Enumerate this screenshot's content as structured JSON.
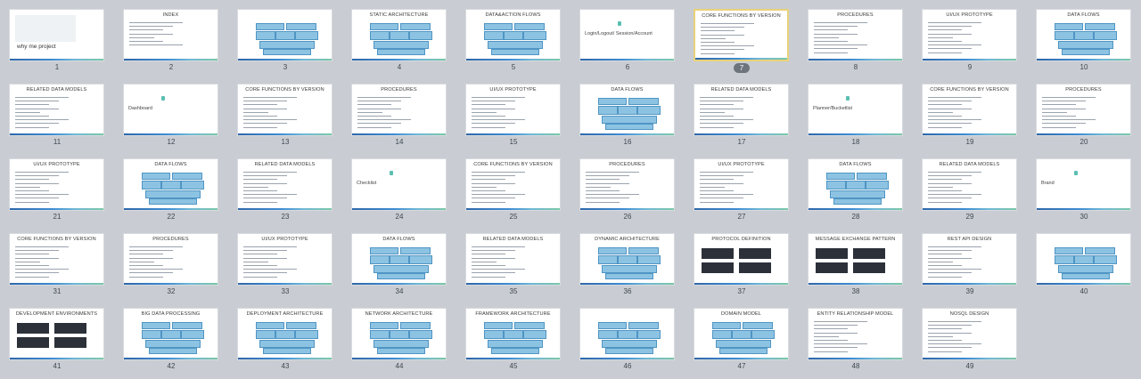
{
  "selected_slide": 7,
  "slides": [
    {
      "n": "1",
      "title": "",
      "kind": "cover",
      "cover_title": "why me project"
    },
    {
      "n": "2",
      "title": "INDEX",
      "kind": "index"
    },
    {
      "n": "3",
      "title": "",
      "kind": "diagram"
    },
    {
      "n": "4",
      "title": "STATIC ARCHITECTURE",
      "kind": "diagram"
    },
    {
      "n": "5",
      "title": "DATA&ACTION FLOWS",
      "kind": "diagram"
    },
    {
      "n": "6",
      "title": "",
      "kind": "section",
      "subtitle": "Login/Logout/ Session/Account"
    },
    {
      "n": "7",
      "title": "CORE FUNCTIONS BY VERSION",
      "kind": "text"
    },
    {
      "n": "8",
      "title": "PROCEDURES",
      "kind": "text"
    },
    {
      "n": "9",
      "title": "UI/UX PROTOTYPE",
      "kind": "text"
    },
    {
      "n": "10",
      "title": "DATA FLOWS",
      "kind": "diagram"
    },
    {
      "n": "11",
      "title": "RELATED DATA MODELS",
      "kind": "text"
    },
    {
      "n": "12",
      "title": "",
      "kind": "section",
      "subtitle": "Dashboard"
    },
    {
      "n": "13",
      "title": "CORE FUNCTIONS BY VERSION",
      "kind": "text"
    },
    {
      "n": "14",
      "title": "PROCEDURES",
      "kind": "text"
    },
    {
      "n": "15",
      "title": "UI/UX PROTOTYPE",
      "kind": "text"
    },
    {
      "n": "16",
      "title": "DATA FLOWS",
      "kind": "diagram"
    },
    {
      "n": "17",
      "title": "RELATED DATA MODELS",
      "kind": "text"
    },
    {
      "n": "18",
      "title": "",
      "kind": "section",
      "subtitle": "Planner/Bucketlist"
    },
    {
      "n": "19",
      "title": "CORE FUNCTIONS BY VERSION",
      "kind": "text"
    },
    {
      "n": "20",
      "title": "PROCEDURES",
      "kind": "text"
    },
    {
      "n": "21",
      "title": "UI/UX PROTOTYPE",
      "kind": "text"
    },
    {
      "n": "22",
      "title": "DATA FLOWS",
      "kind": "diagram"
    },
    {
      "n": "23",
      "title": "RELATED DATA MODELS",
      "kind": "text"
    },
    {
      "n": "24",
      "title": "",
      "kind": "section",
      "subtitle": "Checklist"
    },
    {
      "n": "25",
      "title": "CORE FUNCTIONS BY VERSION",
      "kind": "text"
    },
    {
      "n": "26",
      "title": "PROCEDURES",
      "kind": "text"
    },
    {
      "n": "27",
      "title": "UI/UX PROTOTYPE",
      "kind": "text"
    },
    {
      "n": "28",
      "title": "DATA FLOWS",
      "kind": "diagram"
    },
    {
      "n": "29",
      "title": "RELATED DATA MODELS",
      "kind": "text"
    },
    {
      "n": "30",
      "title": "",
      "kind": "section",
      "subtitle": "Brand"
    },
    {
      "n": "31",
      "title": "CORE FUNCTIONS BY VERSION",
      "kind": "text"
    },
    {
      "n": "32",
      "title": "PROCEDURES",
      "kind": "text"
    },
    {
      "n": "33",
      "title": "UI/UX PROTOTYPE",
      "kind": "text"
    },
    {
      "n": "34",
      "title": "DATA FLOWS",
      "kind": "diagram"
    },
    {
      "n": "35",
      "title": "RELATED DATA MODELS",
      "kind": "text"
    },
    {
      "n": "36",
      "title": "DYNAMIC ARCHITECTURE",
      "kind": "diagram"
    },
    {
      "n": "37",
      "title": "PROTOCOL DEFINITION",
      "kind": "darkdiagram"
    },
    {
      "n": "38",
      "title": "MESSAGE EXCHANGE PATTERN",
      "kind": "darkdiagram"
    },
    {
      "n": "39",
      "title": "REST API DESIGN",
      "kind": "text"
    },
    {
      "n": "40",
      "title": "",
      "kind": "diagram"
    },
    {
      "n": "41",
      "title": "DEVELOPMENT ENVIRONMENTS",
      "kind": "darkdiagram"
    },
    {
      "n": "42",
      "title": "BIG DATA PROCESSING",
      "kind": "diagram"
    },
    {
      "n": "43",
      "title": "DEPLOYMENT ARCHITECTURE",
      "kind": "diagram"
    },
    {
      "n": "44",
      "title": "NETWORK ARCHITECTURE",
      "kind": "diagram"
    },
    {
      "n": "45",
      "title": "FRAMEWORK ARCHITECTURE",
      "kind": "diagram"
    },
    {
      "n": "46",
      "title": "",
      "kind": "diagram"
    },
    {
      "n": "47",
      "title": "DOMAIN MODEL",
      "kind": "diagram"
    },
    {
      "n": "48",
      "title": "ENTITY RELATIONSHIP MODEL",
      "kind": "text"
    },
    {
      "n": "49",
      "title": "NOSQL DESIGN",
      "kind": "text"
    }
  ]
}
